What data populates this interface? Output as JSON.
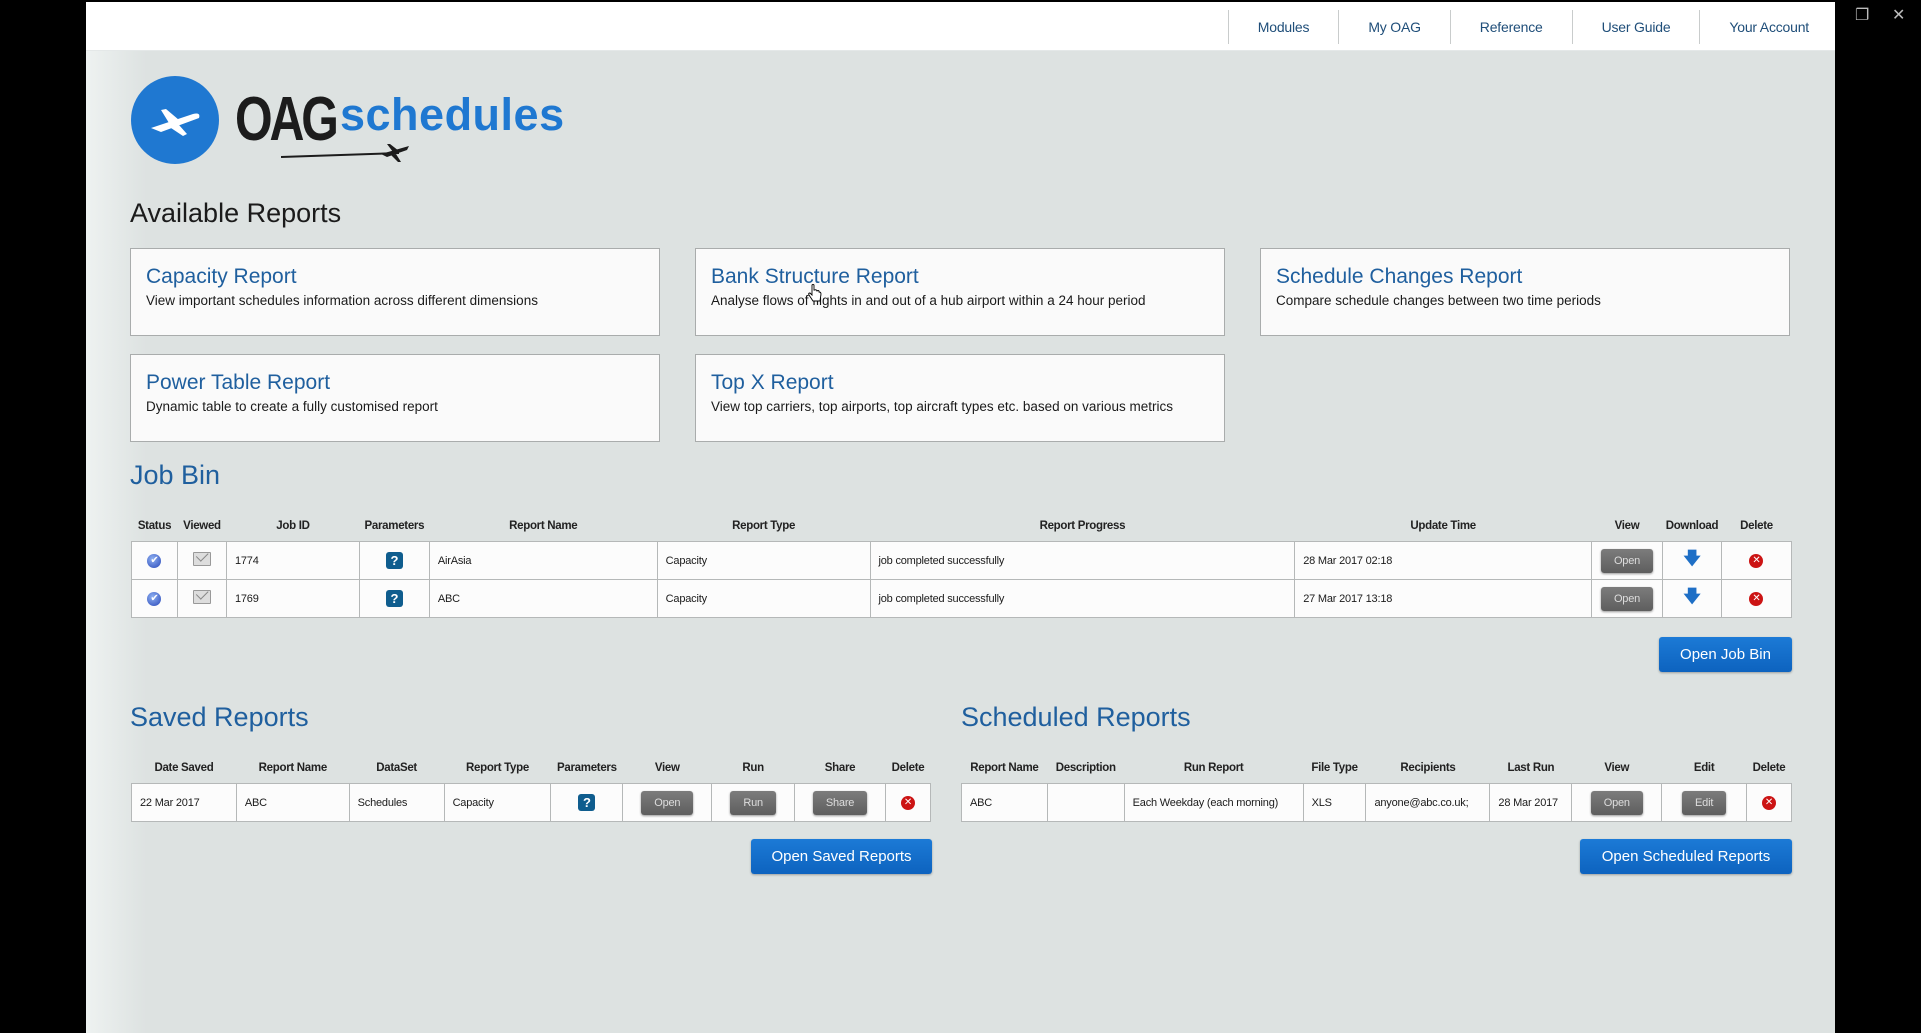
{
  "window_controls": {
    "minimize": "—",
    "restore": "❐",
    "close": "✕"
  },
  "topnav": [
    {
      "label": "Modules"
    },
    {
      "label": "My OAG"
    },
    {
      "label": "Reference"
    },
    {
      "label": "User Guide"
    },
    {
      "label": "Your Account"
    }
  ],
  "logo": {
    "brand": "OAG",
    "product": "schedules",
    "icon": "airplane-icon",
    "color": "#1f78d1"
  },
  "available_reports": {
    "title": "Available Reports",
    "cards": [
      {
        "title": "Capacity Report",
        "desc": "View important schedules information across different dimensions"
      },
      {
        "title": "Bank Structure Report",
        "desc": "Analyse flows of flights in and out of a hub airport within a 24 hour period"
      },
      {
        "title": "Schedule Changes Report",
        "desc": "Compare schedule changes between two time periods"
      },
      {
        "title": "Power Table Report",
        "desc": "Dynamic table to create a fully customised report"
      },
      {
        "title": "Top X Report",
        "desc": "View top carriers, top airports, top aircraft types etc. based on various metrics"
      }
    ]
  },
  "job_bin": {
    "title": "Job Bin",
    "columns": [
      "Status",
      "Viewed",
      "Job ID",
      "Parameters",
      "Report Name",
      "Report Type",
      "Report Progress",
      "Update Time",
      "View",
      "Download",
      "Delete"
    ],
    "rows": [
      {
        "status": "completed",
        "viewed": "envelope-icon",
        "job_id": "1774",
        "report_name": "AirAsia",
        "report_type": "Capacity",
        "progress": "job completed successfully",
        "update_time": "28 Mar 2017 02:18",
        "view_label": "Open"
      },
      {
        "status": "completed",
        "viewed": "envelope-icon",
        "job_id": "1769",
        "report_name": "ABC",
        "report_type": "Capacity",
        "progress": "job completed successfully",
        "update_time": "27 Mar 2017 13:18",
        "view_label": "Open"
      }
    ],
    "open_button": "Open Job Bin"
  },
  "saved_reports": {
    "title": "Saved Reports",
    "columns": [
      "Date Saved",
      "Report Name",
      "DataSet",
      "Report Type",
      "Parameters",
      "View",
      "Run",
      "Share",
      "Delete"
    ],
    "rows": [
      {
        "date_saved": "22 Mar 2017",
        "report_name": "ABC",
        "dataset": "Schedules",
        "report_type": "Capacity",
        "view_label": "Open",
        "run_label": "Run",
        "share_label": "Share"
      }
    ],
    "open_button": "Open Saved Reports"
  },
  "scheduled_reports": {
    "title": "Scheduled Reports",
    "columns": [
      "Report Name",
      "Description",
      "Run Report",
      "File Type",
      "Recipients",
      "Last Run",
      "View",
      "Edit",
      "Delete"
    ],
    "rows": [
      {
        "report_name": "ABC",
        "description": "",
        "run_report": "Each Weekday (each morning)",
        "file_type": "XLS",
        "recipients": "anyone@abc.co.uk;",
        "last_run": "28 Mar 2017",
        "view_label": "Open",
        "edit_label": "Edit"
      }
    ],
    "open_button": "Open Scheduled Reports"
  },
  "icons": {
    "parameters": "?",
    "delete": "✕",
    "download": "🡇",
    "status": "✔"
  },
  "colors": {
    "accent": "#1f78d1",
    "title_blue": "#1f5f9e",
    "delete_red": "#cc1414",
    "param_blue": "#0f5d8e"
  }
}
